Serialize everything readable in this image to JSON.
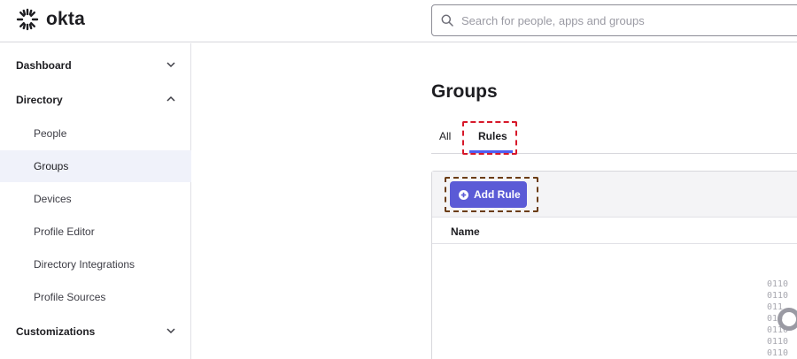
{
  "header": {
    "logo_text": "okta",
    "search_placeholder": "Search for people, apps and groups"
  },
  "sidebar": {
    "sections": [
      {
        "label": "Dashboard",
        "expanded": false
      },
      {
        "label": "Directory",
        "expanded": true
      },
      {
        "label": "Customizations",
        "expanded": false
      }
    ],
    "directory_items": [
      {
        "label": "People",
        "active": false
      },
      {
        "label": "Groups",
        "active": true
      },
      {
        "label": "Devices",
        "active": false
      },
      {
        "label": "Profile Editor",
        "active": false
      },
      {
        "label": "Directory Integrations",
        "active": false
      },
      {
        "label": "Profile Sources",
        "active": false
      }
    ]
  },
  "main": {
    "title": "Groups",
    "tabs": [
      {
        "label": "All",
        "active": false
      },
      {
        "label": "Rules",
        "active": true
      }
    ],
    "add_rule_label": "Add Rule",
    "table_columns": [
      "Name"
    ],
    "loading_text": [
      "0110",
      "0110",
      "011",
      "010",
      "0110",
      "0110",
      "0110"
    ]
  },
  "colors": {
    "accent": "#5b5bd6",
    "tab_underline": "#4f5ef2",
    "highlight_red": "#d7182a",
    "highlight_brown": "#6b3c12"
  }
}
